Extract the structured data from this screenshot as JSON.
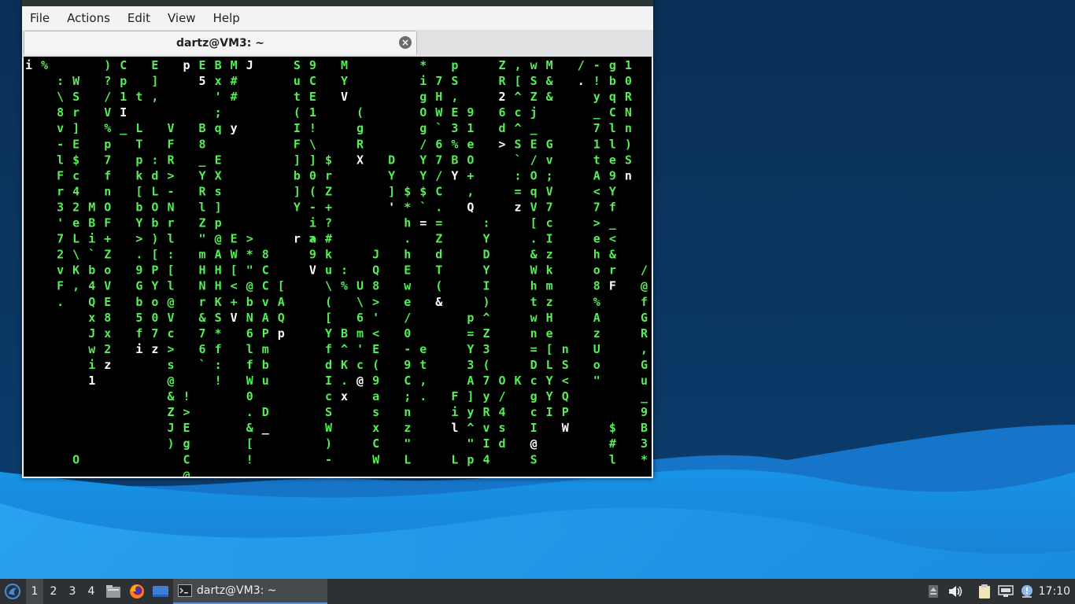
{
  "menu": [
    "File",
    "Actions",
    "Edit",
    "View",
    "Help"
  ],
  "tab": {
    "title": "dartz@VM3: ~",
    "close_icon": "close-icon"
  },
  "terminal": {
    "fg_color": "#55ee55",
    "head_color": "#ffffff",
    "columns": [
      {
        "col": 0,
        "row": 0,
        "chars": "i",
        "head": 0
      },
      {
        "col": 1,
        "row": 0,
        "chars": "%",
        "head": -1
      },
      {
        "col": 1,
        "row": 25,
        "chars": "",
        "head": -1
      },
      {
        "col": 2,
        "row": 1,
        "chars": ":\\8v-lFr3'72vF.",
        "head": -1
      },
      {
        "col": 3,
        "row": 1,
        "chars": "WSr]E$c42eL\\K,",
        "head": -1
      },
      {
        "col": 3,
        "row": 25,
        "chars": "O",
        "head": -1
      },
      {
        "col": 4,
        "row": 9,
        "chars": "MBi`b4QxJwi1",
        "head": 11
      },
      {
        "col": 5,
        "row": 0,
        "chars": ")?/V%p7fnOF+ZoVE8x2z",
        "head": 19
      },
      {
        "col": 6,
        "row": 0,
        "chars": "Cp1I_",
        "head": 3
      },
      {
        "col": 7,
        "row": 2,
        "chars": "t",
        "head": -1
      },
      {
        "col": 7,
        "row": 4,
        "chars": "LTpk[bY>.9Gb5fi",
        "head": 14
      },
      {
        "col": 8,
        "row": 0,
        "chars": "E]",
        "head": -1
      },
      {
        "col": 8,
        "row": 2,
        "chars": ",",
        "head": -1
      },
      {
        "col": 8,
        "row": 6,
        "chars": ":dLOb)[PYo07z",
        "head": 12
      },
      {
        "col": 9,
        "row": 4,
        "chars": "VFR>-Nrl:[l@Vc>s@&Z",
        "head": -1
      },
      {
        "col": 9,
        "row": 22,
        "chars": "ZJ)",
        "head": -1
      },
      {
        "col": 10,
        "row": 0,
        "chars": "p",
        "head": 0
      },
      {
        "col": 10,
        "row": 21,
        "chars": "!>EgC@",
        "head": -1
      },
      {
        "col": 11,
        "row": 0,
        "chars": "E5",
        "head": 1
      },
      {
        "col": 11,
        "row": 4,
        "chars": "B8_YRlZ\"mHNr&76`",
        "head": -1
      },
      {
        "col": 12,
        "row": 0,
        "chars": "Bx';q",
        "head": -1
      },
      {
        "col": 12,
        "row": 6,
        "chars": "EXs]p@AHHKS*f:!",
        "head": 20
      },
      {
        "col": 13,
        "row": 0,
        "chars": "M##",
        "head": -1
      },
      {
        "col": 13,
        "row": 4,
        "chars": "y",
        "head": 0
      },
      {
        "col": 13,
        "row": 11,
        "chars": "EW[<+V",
        "head": 5
      },
      {
        "col": 14,
        "row": 0,
        "chars": "J",
        "head": 0
      },
      {
        "col": 14,
        "row": 11,
        "chars": ">*\"@bN6lfW0.&[!",
        "head": -1
      },
      {
        "col": 15,
        "row": 12,
        "chars": "8CCvAPmbu",
        "head": -1
      },
      {
        "col": 15,
        "row": 22,
        "chars": "D_",
        "head": 1
      },
      {
        "col": 16,
        "row": 14,
        "chars": "[AQp",
        "head": 3
      },
      {
        "col": 17,
        "row": 0,
        "chars": "Sut(IF]b]Y",
        "head": -1
      },
      {
        "col": 17,
        "row": 11,
        "chars": "r",
        "head": 0
      },
      {
        "col": 18,
        "row": 0,
        "chars": "9CE1!\\]0(-i>",
        "head": -1
      },
      {
        "col": 18,
        "row": 11,
        "chars": "a9V",
        "head": 2
      },
      {
        "col": 19,
        "row": 6,
        "chars": "$rZ+?#ku\\([YfdIcSW)-",
        "head": -1
      },
      {
        "col": 20,
        "row": 0,
        "chars": "MYV",
        "head": 2
      },
      {
        "col": 20,
        "row": 13,
        "chars": ":%",
        "head": -1
      },
      {
        "col": 20,
        "row": 17,
        "chars": "B^K.x",
        "head": 4
      },
      {
        "col": 21,
        "row": 3,
        "chars": "(gRX",
        "head": 3
      },
      {
        "col": 21,
        "row": 14,
        "chars": "U\\6m'c@",
        "head": 6
      },
      {
        "col": 22,
        "row": 12,
        "chars": "JQ8>'<E(9asxCW",
        "head": -1
      },
      {
        "col": 23,
        "row": 6,
        "chars": "DY]'",
        "head": 3
      },
      {
        "col": 24,
        "row": 8,
        "chars": "$*h.hEwe/0-9C;nz\"L",
        "head": -1
      },
      {
        "col": 25,
        "row": 0,
        "chars": "*igOg/YY$`",
        "head": -1
      },
      {
        "col": 25,
        "row": 10,
        "chars": "=",
        "head": 0
      },
      {
        "col": 25,
        "row": 18,
        "chars": "et,.",
        "head": -1
      },
      {
        "col": 26,
        "row": 1,
        "chars": "7HW`67/C.=ZdT(&",
        "head": 14
      },
      {
        "col": 27,
        "row": 0,
        "chars": "pS,E3%BY",
        "head": 7
      },
      {
        "col": 27,
        "row": 21,
        "chars": "Fil",
        "head": 2
      },
      {
        "col": 27,
        "row": 25,
        "chars": "L",
        "head": -1
      },
      {
        "col": 28,
        "row": 3,
        "chars": "91eO+,Q",
        "head": 6
      },
      {
        "col": 28,
        "row": 16,
        "chars": "p=Y3A]y^\"p",
        "head": -1
      },
      {
        "col": 29,
        "row": 10,
        "chars": ":YDYI)^Z3(7yRvI4",
        "head": -1
      },
      {
        "col": 30,
        "row": 0,
        "chars": "ZR2",
        "head": 2
      },
      {
        "col": 30,
        "row": 3,
        "chars": "6d>",
        "head": 2
      },
      {
        "col": 30,
        "row": 20,
        "chars": "O/4sd",
        "head": -1
      },
      {
        "col": 31,
        "row": 0,
        "chars": ",[^c^S`:=z",
        "head": 9
      },
      {
        "col": 31,
        "row": 20,
        "chars": "K",
        "head": -1
      },
      {
        "col": 32,
        "row": 0,
        "chars": "wSZj_E/OqV[.&Whtwn=DcgcI@S",
        "head": 24
      },
      {
        "col": 32,
        "row": 25,
        "chars": "",
        "head": -1
      },
      {
        "col": 33,
        "row": 0,
        "chars": "M&&",
        "head": -1
      },
      {
        "col": 33,
        "row": 5,
        "chars": "Gv;V7cIzkmzHe[LYYI",
        "head": -1
      },
      {
        "col": 34,
        "row": 18,
        "chars": "nS<QPW",
        "head": 5
      },
      {
        "col": 35,
        "row": 0,
        "chars": "/.",
        "head": 1
      },
      {
        "col": 36,
        "row": 0,
        "chars": "-!y_71tA<7>eho8%AzUo\"",
        "head": -1
      },
      {
        "col": 37,
        "row": 0,
        "chars": "gbqClle9Yf_<&rF",
        "head": 14
      },
      {
        "col": 37,
        "row": 23,
        "chars": "$#l",
        "head": -1
      },
      {
        "col": 38,
        "row": 0,
        "chars": "10RNn)Sn",
        "head": 7
      },
      {
        "col": 39,
        "row": 13,
        "chars": "/@fGR,Gu_9B3*",
        "head": -1
      }
    ]
  },
  "taskbar": {
    "start_icon": "start-menu-icon",
    "workspaces": [
      "1",
      "2",
      "3",
      "4"
    ],
    "launchers": [
      "file-manager-icon",
      "firefox-icon",
      "desktop-icon"
    ],
    "task_label": "dartz@VM3: ~",
    "tray": [
      "eject-icon",
      "volume-icon",
      "clipboard-icon",
      "network-icon",
      "update-notifier-icon"
    ],
    "clock": "17:10"
  }
}
